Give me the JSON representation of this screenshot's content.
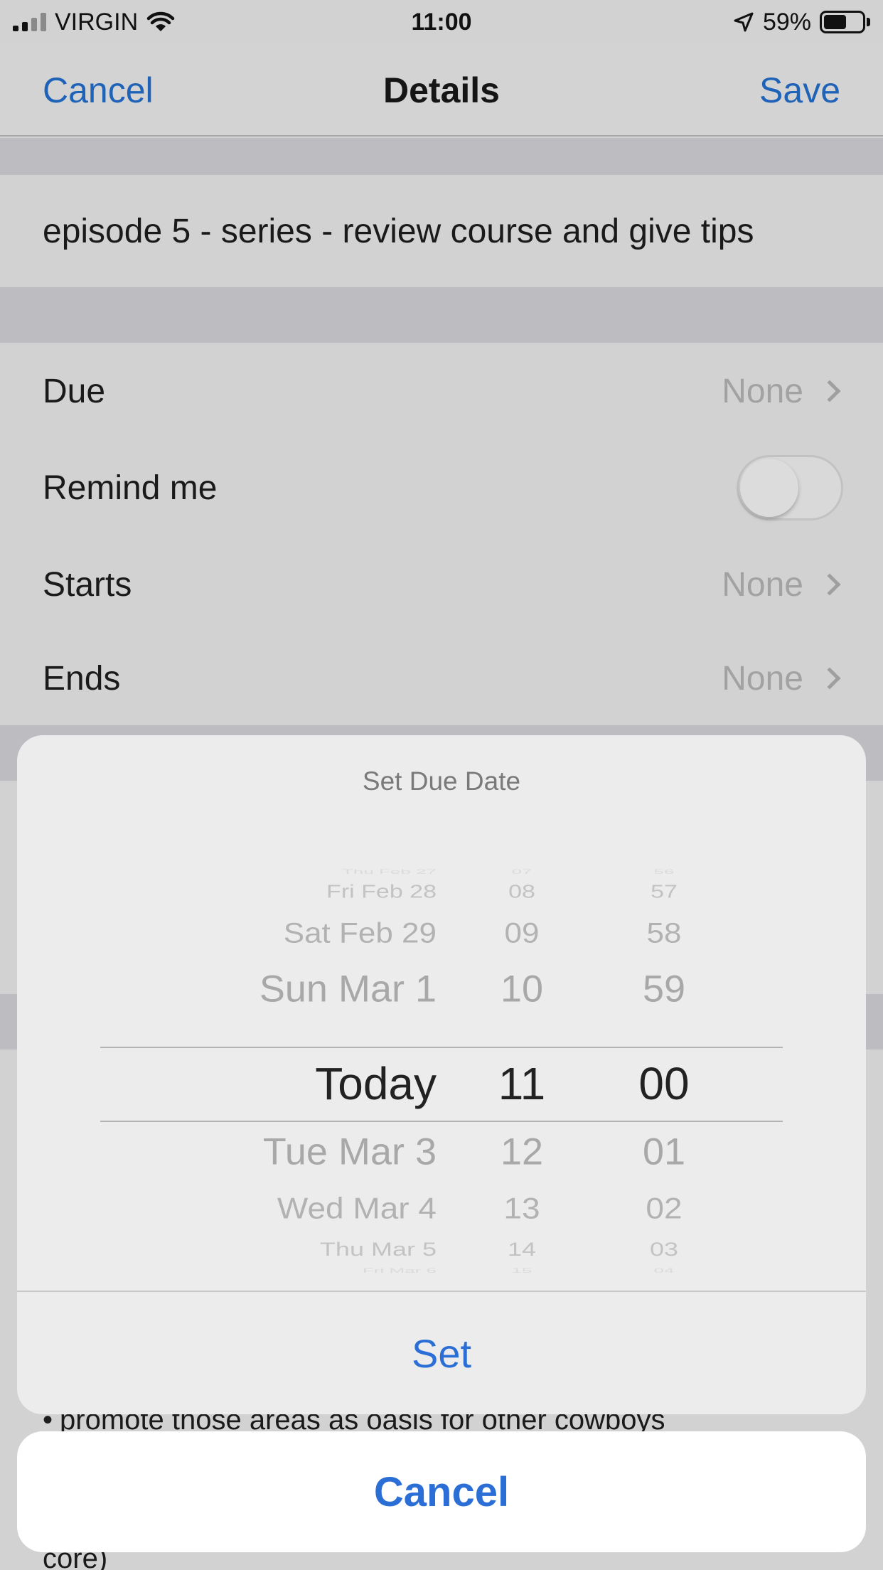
{
  "status_bar": {
    "carrier": "VIRGIN",
    "time": "11:00",
    "battery": "59%",
    "battery_level": 0.59
  },
  "nav": {
    "cancel": "Cancel",
    "title": "Details",
    "save": "Save"
  },
  "task": {
    "title": "episode 5 - series - review course and give tips"
  },
  "rows": {
    "due": {
      "label": "Due",
      "value": "None"
    },
    "remind": {
      "label": "Remind me",
      "on": false
    },
    "starts": {
      "label": "Starts",
      "value": "None"
    },
    "ends": {
      "label": "Ends",
      "value": "None"
    }
  },
  "notes": {
    "line1": "promote those areas as oasis for other cowboys",
    "line2": "core)"
  },
  "sheet": {
    "title": "Set Due Date",
    "set": "Set",
    "cancel": "Cancel",
    "picker": {
      "dates": [
        "Thu Feb 27",
        "Fri Feb 28",
        "Sat Feb 29",
        "Sun Mar 1",
        "Today",
        "Tue Mar 3",
        "Wed Mar 4",
        "Thu Mar 5",
        "Fri Mar 6"
      ],
      "hours": [
        "07",
        "08",
        "09",
        "10",
        "11",
        "12",
        "13",
        "14",
        "15"
      ],
      "minutes": [
        "56",
        "57",
        "58",
        "59",
        "00",
        "01",
        "02",
        "03",
        "04"
      ],
      "selected_index": 4
    }
  }
}
